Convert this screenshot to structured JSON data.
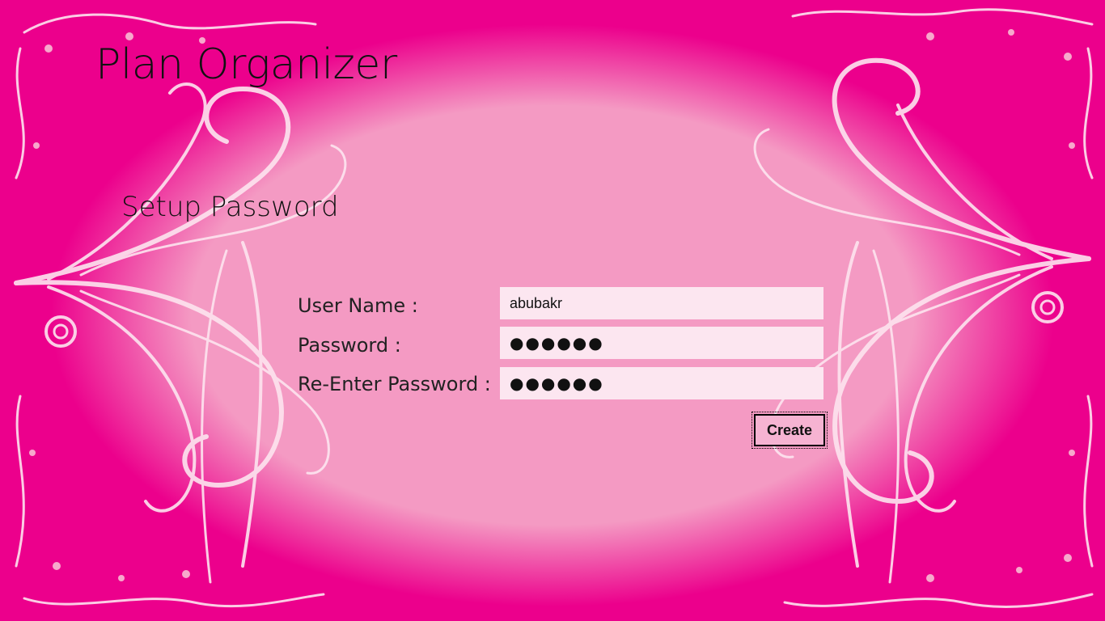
{
  "app": {
    "title": "Plan Organizer"
  },
  "page": {
    "heading": "Setup Password"
  },
  "form": {
    "username": {
      "label": "User Name :",
      "value": "abubakr"
    },
    "password": {
      "label": "Password :",
      "value": "●●●●●●"
    },
    "reenter_password": {
      "label": "Re-Enter Password :",
      "value": "●●●●●●"
    },
    "create_label": "Create"
  },
  "colors": {
    "frame": "#ec008c",
    "panel": "#f49ac3",
    "field": "#fce6f0",
    "ornament": "#fde4ef"
  },
  "decor": {
    "icon": "floral-swirl-frame"
  }
}
